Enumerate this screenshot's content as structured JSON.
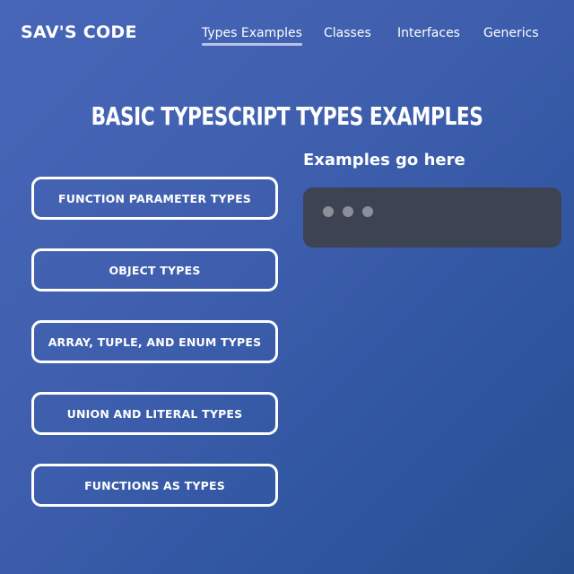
{
  "header": {
    "brand": "SAV'S CODE",
    "nav": [
      {
        "label": "Types Examples",
        "active": true
      },
      {
        "label": "Classes",
        "active": false
      },
      {
        "label": "Interfaces",
        "active": false
      },
      {
        "label": "Generics",
        "active": false
      }
    ]
  },
  "main": {
    "title": "BASIC TYPESCRIPT TYPES EXAMPLES",
    "buttons": [
      {
        "label": "FUNCTION PARAMETER TYPES"
      },
      {
        "label": "OBJECT TYPES"
      },
      {
        "label": "ARRAY, TUPLE, AND ENUM TYPES"
      },
      {
        "label": "UNION AND LITERAL TYPES"
      },
      {
        "label": "FUNCTIONS AS TYPES"
      }
    ],
    "examples_heading": "Examples go here"
  },
  "colors": {
    "background_start": "#4866b8",
    "background_end": "#27508f",
    "code_window": "#3d4352",
    "window_dot": "#8a8f99",
    "nav_underline": "#b8c4e6"
  }
}
